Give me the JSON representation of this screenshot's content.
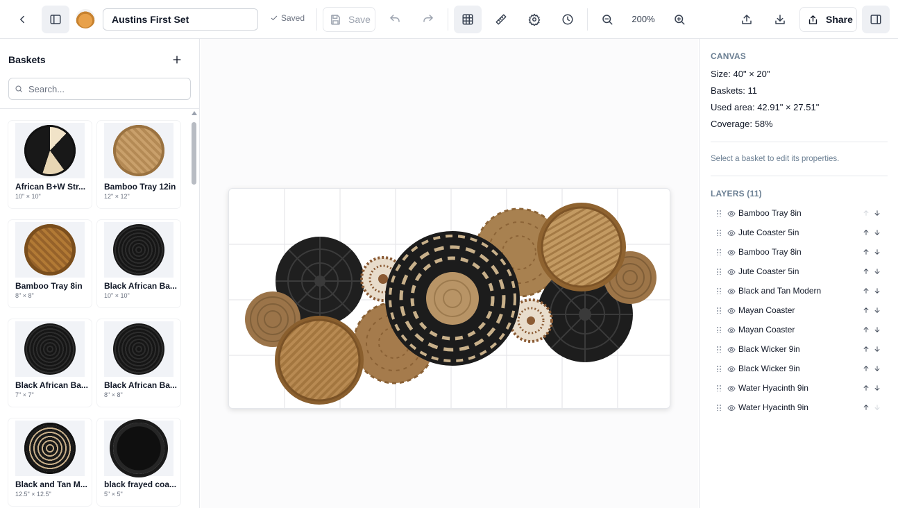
{
  "toolbar": {
    "set_title": "Austins First Set",
    "saved_label": "Saved",
    "save_label": "Save",
    "zoom": "200%",
    "share_label": "Share"
  },
  "sidebar": {
    "title": "Baskets",
    "search_placeholder": "Search...",
    "baskets": [
      {
        "name": "African B+W Str...",
        "size": "10\" × 10\"",
        "style": "bw"
      },
      {
        "name": "Bamboo Tray 12in",
        "size": "12\" × 12\"",
        "style": "bamboo-light"
      },
      {
        "name": "Bamboo Tray 8in",
        "size": "8\" × 8\"",
        "style": "bamboo"
      },
      {
        "name": "Black African Ba...",
        "size": "10\" × 10\"",
        "style": "black"
      },
      {
        "name": "Black African Ba...",
        "size": "7\" × 7\"",
        "style": "black"
      },
      {
        "name": "Black African Ba...",
        "size": "8\" × 8\"",
        "style": "black"
      },
      {
        "name": "Black and Tan M...",
        "size": "12.5\" × 12.5\"",
        "style": "blacktan"
      },
      {
        "name": "black frayed coa...",
        "size": "5\" × 5\"",
        "style": "frayed"
      }
    ]
  },
  "canvas_panel": {
    "heading": "CANVAS",
    "size": "Size: 40\" × 20\"",
    "baskets": "Baskets: 11",
    "used_area": "Used area: 42.91\" × 27.51\"",
    "coverage": "Coverage: 58%",
    "hint": "Select a basket to edit its properties."
  },
  "layers": {
    "heading": "LAYERS (11)",
    "items": [
      {
        "name": "Bamboo Tray 8in",
        "up_enabled": false,
        "down_enabled": true
      },
      {
        "name": "Jute Coaster 5in",
        "up_enabled": true,
        "down_enabled": true
      },
      {
        "name": "Bamboo Tray 8in",
        "up_enabled": true,
        "down_enabled": true
      },
      {
        "name": "Jute Coaster 5in",
        "up_enabled": true,
        "down_enabled": true
      },
      {
        "name": "Black and Tan Modern",
        "up_enabled": true,
        "down_enabled": true
      },
      {
        "name": "Mayan Coaster",
        "up_enabled": true,
        "down_enabled": true
      },
      {
        "name": "Mayan Coaster",
        "up_enabled": true,
        "down_enabled": true
      },
      {
        "name": "Black Wicker 9in",
        "up_enabled": true,
        "down_enabled": true
      },
      {
        "name": "Black Wicker 9in",
        "up_enabled": true,
        "down_enabled": true
      },
      {
        "name": "Water Hyacinth 9in",
        "up_enabled": true,
        "down_enabled": true
      },
      {
        "name": "Water Hyacinth 9in",
        "up_enabled": true,
        "down_enabled": false
      }
    ]
  },
  "colors": {
    "accent_muted": "#6b7f93",
    "border": "#e5e7eb",
    "bamboo": "#b8894f",
    "jute": "#9a7247",
    "black_wicker": "#1f1f1f",
    "hyacinth": "#a67c4e"
  }
}
